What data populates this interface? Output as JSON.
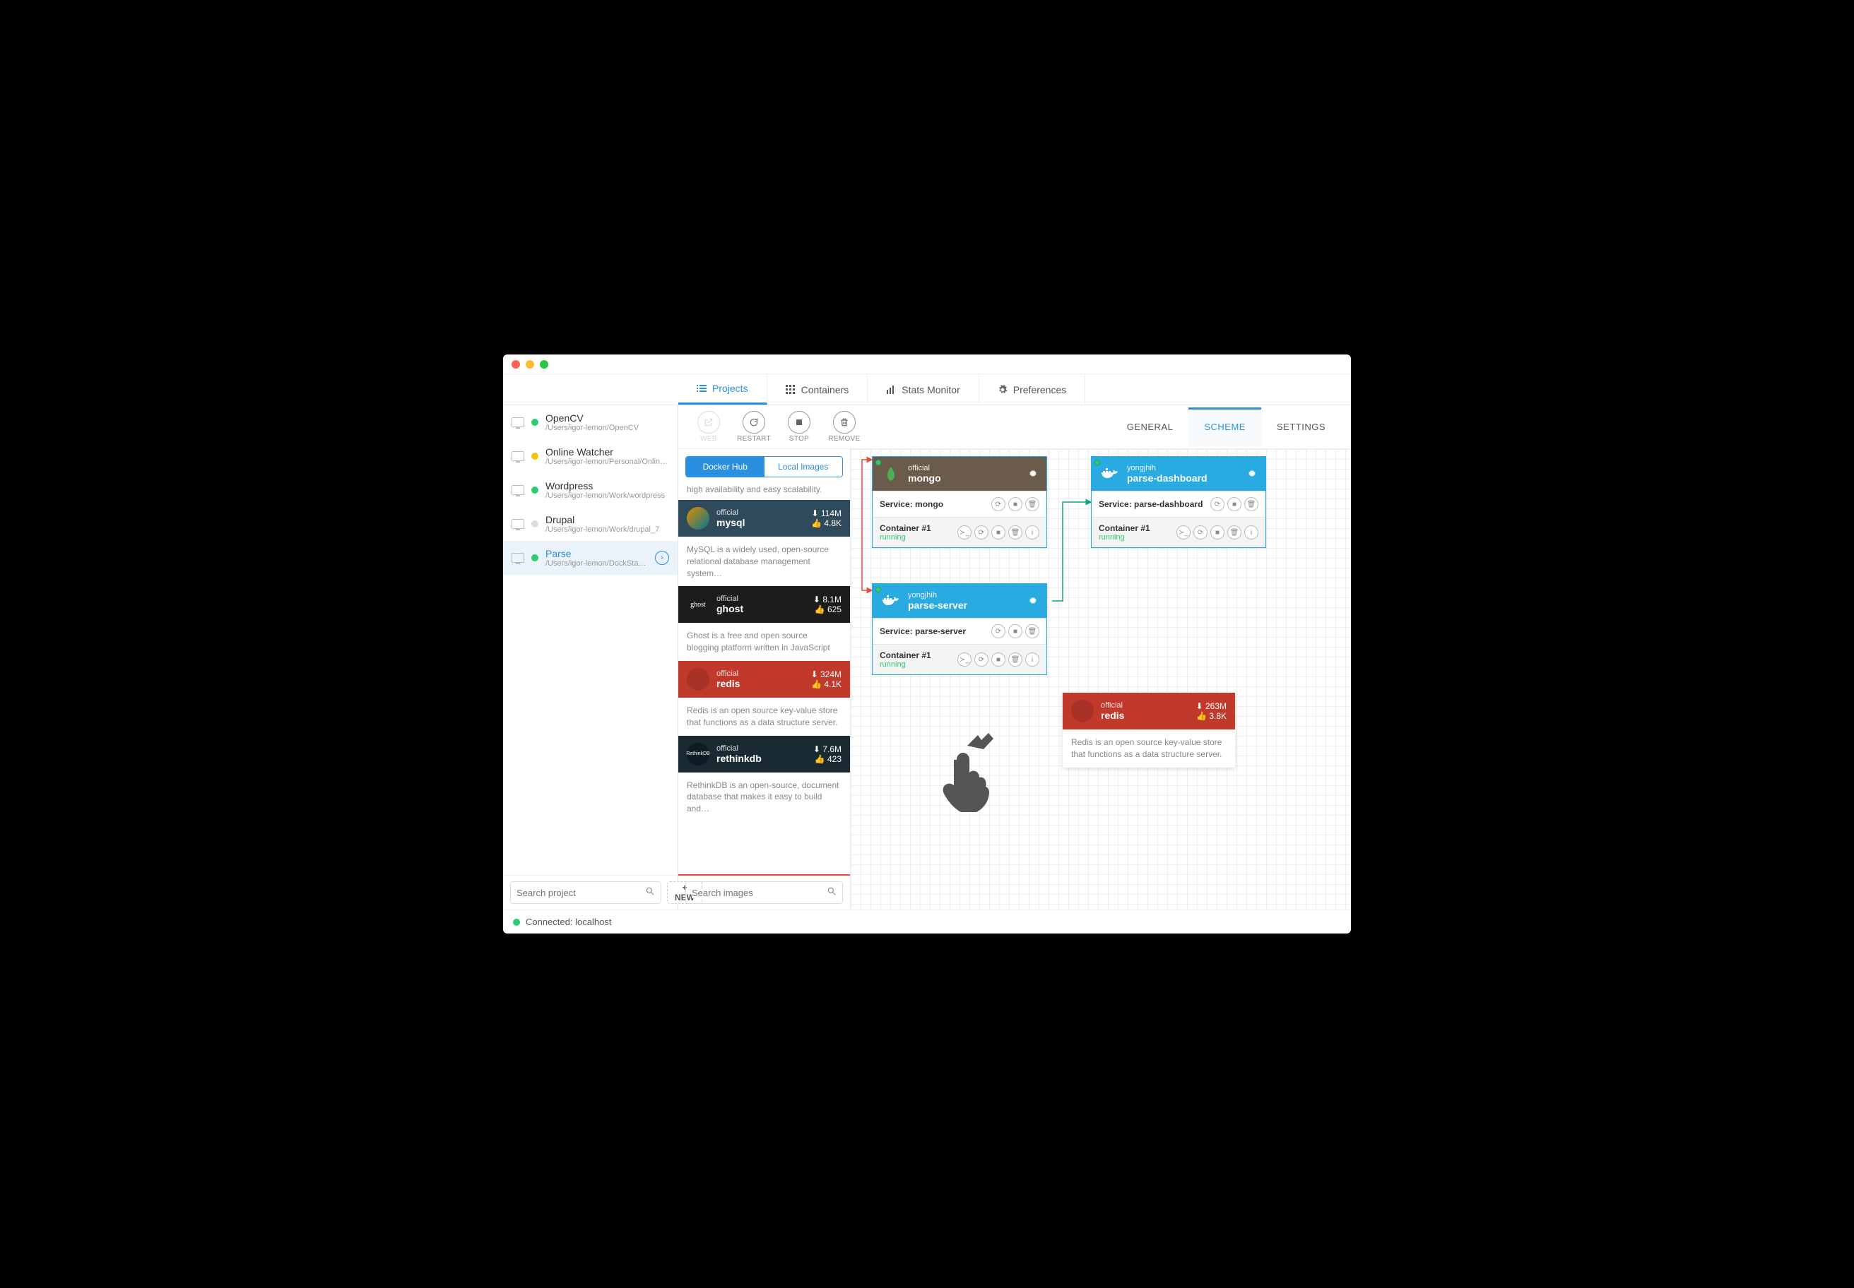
{
  "tabs": {
    "projects": "Projects",
    "containers": "Containers",
    "stats": "Stats Monitor",
    "preferences": "Preferences"
  },
  "projects": [
    {
      "name": "OpenCV",
      "path": "/Users/igor-lemon/OpenCV",
      "status": "#2ecc71"
    },
    {
      "name": "Online Watcher",
      "path": "/Users/igor-lemon/Personal/Online...",
      "status": "#f1c40f"
    },
    {
      "name": "Wordpress",
      "path": "/Users/igor-lemon/Work/wordpress",
      "status": "#2ecc71"
    },
    {
      "name": "Drupal",
      "path": "/Users/igor-lemon/Work/drupal_7",
      "status": "#dcdcdc"
    },
    {
      "name": "Parse",
      "path": "/Users/igor-lemon/DockStation/Pa...",
      "status": "#2ecc71"
    }
  ],
  "sidebar": {
    "searchPlaceholder": "Search project",
    "newLabel": "+ NEW"
  },
  "toolbar": {
    "web": "WEB",
    "restart": "RESTART",
    "stop": "STOP",
    "remove": "REMOVE"
  },
  "viewTabs": {
    "general": "GENERAL",
    "scheme": "SCHEME",
    "settings": "SETTINGS"
  },
  "imageSource": {
    "hub": "Docker Hub",
    "local": "Local Images"
  },
  "imagesTruncated": "high availability and easy scalability.",
  "images": [
    {
      "publisher": "official",
      "name": "mysql",
      "downloads": "114M",
      "stars": "4.8K",
      "desc": "MySQL is a widely used, open-source relational database management system…",
      "cls": "mysql"
    },
    {
      "publisher": "official",
      "name": "ghost",
      "downloads": "8.1M",
      "stars": "625",
      "desc": "Ghost is a free and open source blogging platform written in JavaScript",
      "cls": "ghost"
    },
    {
      "publisher": "official",
      "name": "redis",
      "downloads": "324M",
      "stars": "4.1K",
      "desc": "Redis is an open source key-value store that functions as a data structure server.",
      "cls": "redis"
    },
    {
      "publisher": "official",
      "name": "rethinkdb",
      "downloads": "7.6M",
      "stars": "423",
      "desc": "RethinkDB is an open-source, document database that makes it easy to build and…",
      "cls": "rethinkdb"
    }
  ],
  "imageSearchPlaceholder": "Search images",
  "nodes": {
    "mongo": {
      "publisher": "official",
      "name": "mongo",
      "service": "Service: mongo",
      "container": "Container #1",
      "status": "running"
    },
    "parseServer": {
      "publisher": "yongjhih",
      "name": "parse-server",
      "service": "Service: parse-server",
      "container": "Container #1",
      "status": "running"
    },
    "parseDashboard": {
      "publisher": "yongjhih",
      "name": "parse-dashboard",
      "service": "Service: parse-dashboard",
      "container": "Container #1",
      "status": "running"
    }
  },
  "floatCard": {
    "publisher": "official",
    "name": "redis",
    "downloads": "263M",
    "stars": "3.8K",
    "desc": "Redis is an open source key-value store that functions as a data structure server."
  },
  "footer": {
    "connected": "Connected: localhost"
  }
}
